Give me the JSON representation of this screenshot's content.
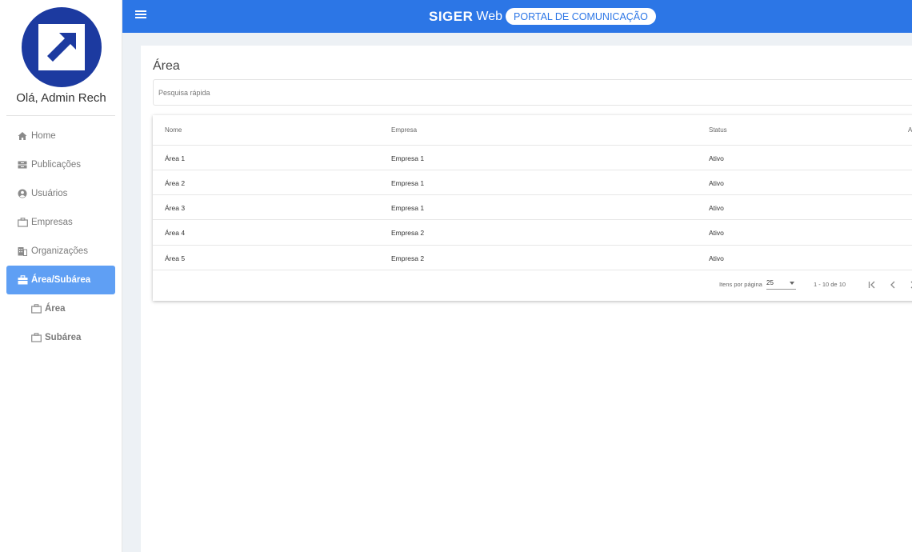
{
  "sidebar": {
    "greeting": "Olá, Admin Rech",
    "items": [
      {
        "label": "Home"
      },
      {
        "label": "Publicações"
      },
      {
        "label": "Usuários"
      },
      {
        "label": "Empresas"
      },
      {
        "label": "Organizações"
      },
      {
        "label": "Área/Subárea",
        "active": true
      },
      {
        "label": "Área"
      },
      {
        "label": "Subárea"
      }
    ],
    "active_color": "#5f9ff4"
  },
  "topbar": {
    "brand_siger": "SIGER",
    "brand_web": "Web",
    "brand_portal": "PORTAL DE COMUNICAÇÃO",
    "color": "#2c76e6"
  },
  "main": {
    "title": "Área",
    "search_placeholder": "Pesquisa rápida",
    "table": {
      "headers": [
        "Nome",
        "Empresa",
        "Status",
        "A"
      ],
      "rows": [
        [
          "Área 1",
          "Empresa 1",
          "Ativo"
        ],
        [
          "Área 2",
          "Empresa 1",
          "Ativo"
        ],
        [
          "Área 3",
          "Empresa 1",
          "Ativo"
        ],
        [
          "Área 4",
          "Empresa 2",
          "Ativo"
        ],
        [
          "Área 5",
          "Empresa 2",
          "Ativo"
        ]
      ]
    },
    "paginator": {
      "items_label": "Itens por página",
      "page_size": "25",
      "range": "1 - 10 de 10"
    }
  }
}
